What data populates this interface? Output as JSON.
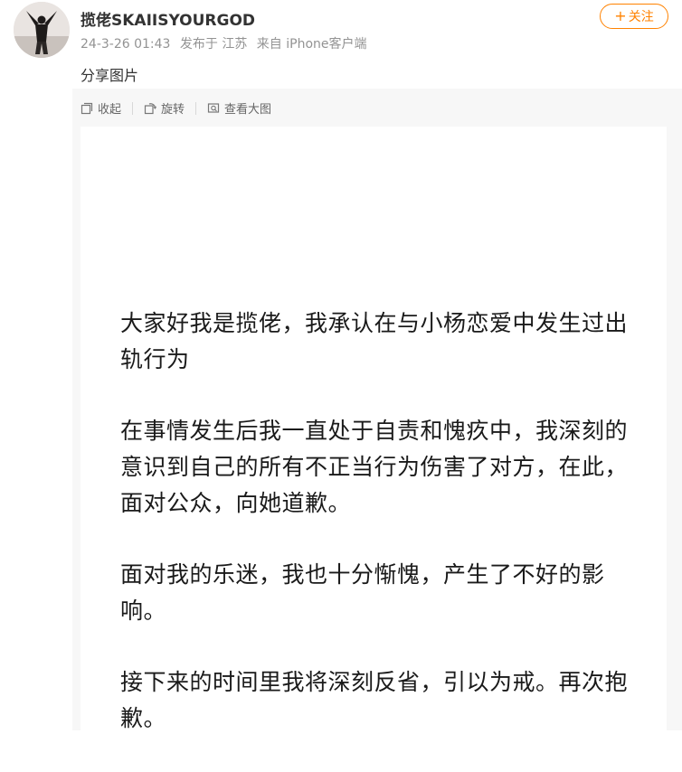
{
  "user": {
    "name": "揽佬SKAIISYOURGOD",
    "avatar_icon": "user-avatar"
  },
  "meta": {
    "time": "24-3-26 01:43",
    "location": "发布于 江苏",
    "source": "来自 iPhone客户端"
  },
  "follow_button": {
    "plus": "+",
    "label": "关注",
    "color": "#ff8200"
  },
  "post": {
    "text": "分享图片"
  },
  "toolbar": {
    "collapse_label": "收起",
    "rotate_label": "旋转",
    "view_large_label": "查看大图"
  },
  "image": {
    "paragraphs": [
      "大家好我是揽佬，我承认在与小杨恋爱中发生过出轨行为",
      "在事情发生后我一直处于自责和愧疚中，我深刻的意识到自己的所有不正当行为伤害了对方，在此，面对公众，向她道歉。",
      "面对我的乐迷，我也十分惭愧，产生了不好的影响。",
      "接下来的时间里我将深刻反省，引以为戒。再次抱歉。"
    ]
  }
}
